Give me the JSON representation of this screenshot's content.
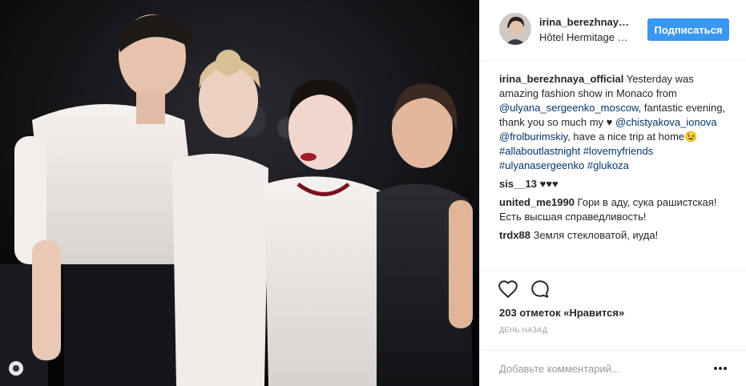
{
  "post": {
    "author": "irina_berezhnaya_official",
    "location": "Hôtel Hermitage Monte-Carlo",
    "follow_label": "Подписаться"
  },
  "comments": [
    {
      "user": "irina_berezhnaya_official",
      "parts": [
        {
          "text": " Yesterday was amazing fashion show in Monaco from ",
          "type": "text"
        },
        {
          "text": "@ulyana_sergeenko_moscow",
          "type": "link"
        },
        {
          "text": ", fantastic evening, thank you so much my ♥ ",
          "type": "text"
        },
        {
          "text": "@chistyakova_ionova",
          "type": "link"
        },
        {
          "text": " ",
          "type": "text"
        },
        {
          "text": "@frolburimskiy",
          "type": "link"
        },
        {
          "text": ", have a nice trip at home😉 ",
          "type": "text"
        },
        {
          "text": "#allaboutlastnight",
          "type": "link"
        },
        {
          "text": " ",
          "type": "text"
        },
        {
          "text": "#lovemyfriends",
          "type": "link"
        },
        {
          "text": " ",
          "type": "text"
        },
        {
          "text": "#ulyanasergeenko",
          "type": "link"
        },
        {
          "text": " ",
          "type": "text"
        },
        {
          "text": "#glukoza",
          "type": "link"
        }
      ]
    },
    {
      "user": "sis__13",
      "parts": [
        {
          "text": " ♥♥♥",
          "type": "text"
        }
      ]
    },
    {
      "user": "united_me1990",
      "parts": [
        {
          "text": " Гори в аду, сука рашистская! Есть высшая справедливость!",
          "type": "text"
        }
      ]
    },
    {
      "user": "trdx88",
      "parts": [
        {
          "text": " Земля стекловатой, иуда!",
          "type": "text"
        }
      ]
    }
  ],
  "actions": {
    "like_icon": "heart-icon",
    "comment_icon": "comment-icon",
    "likes_text": "203 отметок «Нравится»",
    "time_text": "ДЕНЬ НАЗАД"
  },
  "add_comment": {
    "placeholder": "Добавьте комментарий...",
    "more_icon": "more-options-icon"
  },
  "colors": {
    "follow_button": "#3897f0",
    "link": "#003569",
    "border": "#efefef",
    "muted": "#999999"
  }
}
